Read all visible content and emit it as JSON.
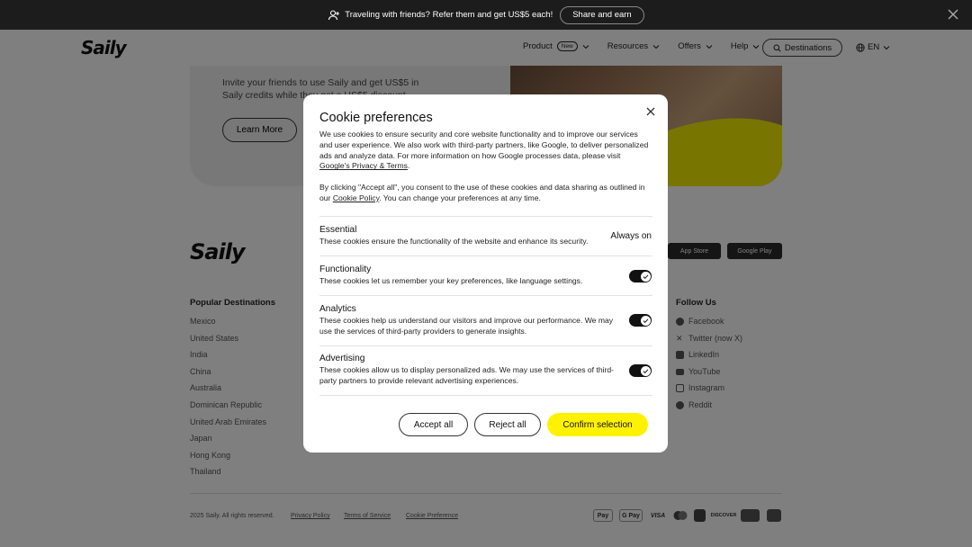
{
  "promo": {
    "text": "Traveling with friends? Refer them and get US$5 each!",
    "button": "Share and earn"
  },
  "nav": {
    "logo": "Saily",
    "items": [
      {
        "label": "Product",
        "badge": "New"
      },
      {
        "label": "Resources"
      },
      {
        "label": "Offers"
      },
      {
        "label": "Help"
      }
    ],
    "destinations": "Destinations",
    "language": "EN"
  },
  "referral": {
    "text": "Invite your friends to use Saily and get US$5 in Saily credits while they get a US$5 discount.",
    "learn_more": "Learn More"
  },
  "footer": {
    "logo": "Saily",
    "app_store": "App Store",
    "google_play": "Google Play",
    "popular_title": "Popular Destinations",
    "destinations": [
      "Mexico",
      "United States",
      "India",
      "China",
      "Australia",
      "Dominican Republic",
      "United Arab Emirates",
      "Japan",
      "Hong Kong",
      "Thailand"
    ],
    "follow_title": "Follow Us",
    "social": [
      "Facebook",
      "Twitter (now X)",
      "LinkedIn",
      "YouTube",
      "Instagram",
      "Reddit"
    ],
    "copyright": "2025 Saily. All rights reserved.",
    "privacy": "Privacy Policy",
    "terms": "Terms of Service",
    "cookie_pref": "Cookie Preference",
    "payments": [
      "Pay",
      "G Pay",
      "VISA",
      "",
      "",
      "DISCOVER",
      "",
      ""
    ]
  },
  "modal": {
    "title": "Cookie preferences",
    "intro": "We use cookies to ensure security and core website functionality and to improve our services and user experience. We also work with third-party partners, like Google, to deliver personalized ads and analyze data. For more information on how Google processes data, please visit ",
    "intro_link": "Google's Privacy & Terms",
    "consent_pre": "By clicking \"Accept all\", you consent to the use of these cookies and data sharing as outlined in our ",
    "consent_link": "Cookie Policy",
    "consent_post": ". You can change your preferences at any time.",
    "sections": [
      {
        "title": "Essential",
        "desc": "These cookies ensure the functionality of the website and enhance its security.",
        "status": "Always on"
      },
      {
        "title": "Functionality",
        "desc": "These cookies let us remember your key preferences, like language settings.",
        "enabled": true
      },
      {
        "title": "Analytics",
        "desc": "These cookies help us understand our visitors and improve our performance. We may use the services of third-party providers to generate insights.",
        "enabled": true
      },
      {
        "title": "Advertising",
        "desc": "These cookies allow us to display personalized ads. We may use the services of third-party partners to provide relevant advertising experiences.",
        "enabled": true
      }
    ],
    "accept": "Accept all",
    "reject": "Reject all",
    "confirm": "Confirm selection"
  }
}
